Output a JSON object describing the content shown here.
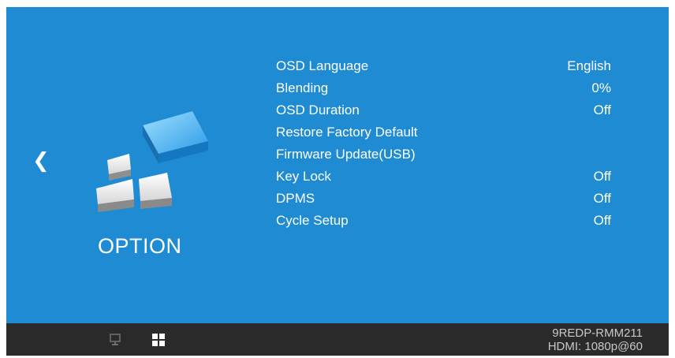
{
  "category": {
    "label": "OPTION",
    "icon": "option-blocks-icon"
  },
  "nav": {
    "back_glyph": "❮"
  },
  "menu": {
    "items": [
      {
        "label": "OSD Language",
        "value": "English"
      },
      {
        "label": "Blending",
        "value": "0%"
      },
      {
        "label": "OSD Duration",
        "value": "Off"
      },
      {
        "label": "Restore Factory Default",
        "value": ""
      },
      {
        "label": "Firmware Update(USB)",
        "value": ""
      },
      {
        "label": "Key Lock",
        "value": "Off"
      },
      {
        "label": "DPMS",
        "value": "Off"
      },
      {
        "label": "Cycle Setup",
        "value": "Off"
      }
    ]
  },
  "bottom_bar": {
    "icons": [
      "monitor-icon",
      "option-grid-icon"
    ],
    "model": "9REDP-RMM211",
    "signal": "HDMI: 1080p@60"
  },
  "colors": {
    "background": "#1f8bd2",
    "bar": "#2a2a2a",
    "text": "#ffffff"
  }
}
